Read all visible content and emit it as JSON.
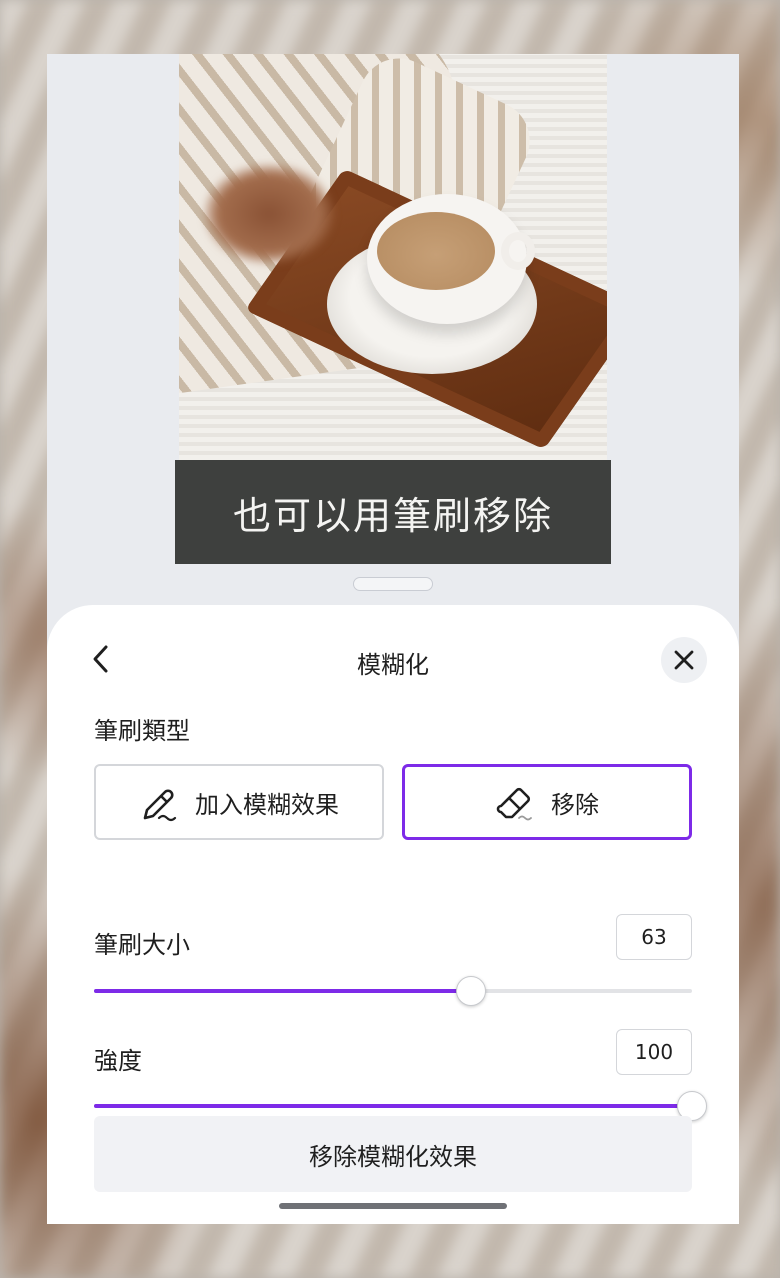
{
  "caption": "也可以用筆刷移除",
  "sheet": {
    "title": "模糊化",
    "brush_type_label": "筆刷類型",
    "brush_options": [
      {
        "label": "加入模糊效果",
        "icon": "brush-pen-icon",
        "selected": false
      },
      {
        "label": "移除",
        "icon": "eraser-icon",
        "selected": true
      }
    ],
    "brush_size": {
      "label": "筆刷大小",
      "value": "63",
      "fraction": 0.63
    },
    "intensity": {
      "label": "強度",
      "value": "100",
      "fraction": 1.0
    },
    "remove_all_label": "移除模糊化效果"
  },
  "colors": {
    "accent": "#7d2ae8",
    "caption_bg": "#3e403e",
    "sheet_bg": "#ffffff"
  },
  "icons": [
    "chevron-left-icon",
    "close-icon",
    "brush-pen-icon",
    "eraser-icon"
  ]
}
